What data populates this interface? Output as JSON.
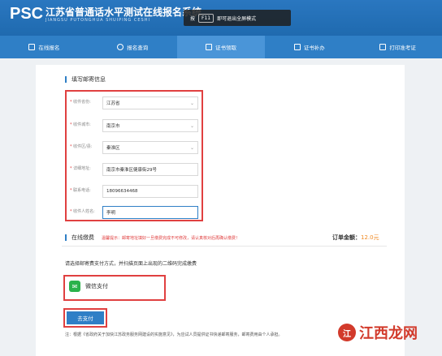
{
  "header": {
    "logo": "PSC",
    "title": "江苏省普通话水平测试在线报名系统",
    "subtitle": "JIANGSU PUTONGHUA SHUIPING CESHI",
    "fullscreen_toast": {
      "prefix": "按",
      "key": "F11",
      "suffix": "即可退出全屏模式"
    }
  },
  "nav": {
    "items": [
      {
        "label": "在线报名",
        "icon": "edit-icon",
        "active": false
      },
      {
        "label": "报名查询",
        "icon": "search-icon",
        "active": false
      },
      {
        "label": "证书领取",
        "icon": "certificate-icon",
        "active": true
      },
      {
        "label": "证书补办",
        "icon": "reissue-icon",
        "active": false
      },
      {
        "label": "打印准考证",
        "icon": "print-icon",
        "active": false
      }
    ]
  },
  "mail_section": {
    "title": "填写邮寄信息",
    "fields": [
      {
        "label": "收件省份:",
        "value": "江苏省",
        "type": "select"
      },
      {
        "label": "收件城市:",
        "value": "南京市",
        "type": "select"
      },
      {
        "label": "收件区/县:",
        "value": "秦淮区",
        "type": "select"
      },
      {
        "label": "详细地址:",
        "value": "南京市秦淮区健康街29号",
        "type": "text"
      },
      {
        "label": "联系电话:",
        "value": "18096634468",
        "type": "text"
      },
      {
        "label": "收件人姓名:",
        "value": "李明",
        "type": "text"
      }
    ]
  },
  "payment": {
    "title": "在线缴费",
    "warning": "温馨提示：邮寄地址填好一旦缴费完成不可修改，请认真核对后再确认缴费！",
    "amount_label": "订单金额：",
    "amount_value": "12.0元",
    "instruction": "请选择邮寄费支付方式，并扫描页面上出现的二维码完成缴费",
    "method": "微信支付",
    "pay_button": "去支付",
    "note": "注：根据《省政府关于加快江苏政务服务网建设的实施意见》，为应试人员提供证书快递邮寄服务，邮寄费用由个人承担。"
  },
  "watermark": {
    "badge": "江",
    "text": "江西龙网"
  },
  "colors": {
    "brand": "#2f7fc6",
    "highlight": "#e04040",
    "amount": "#f08a24",
    "wechat": "#2ab24b"
  }
}
